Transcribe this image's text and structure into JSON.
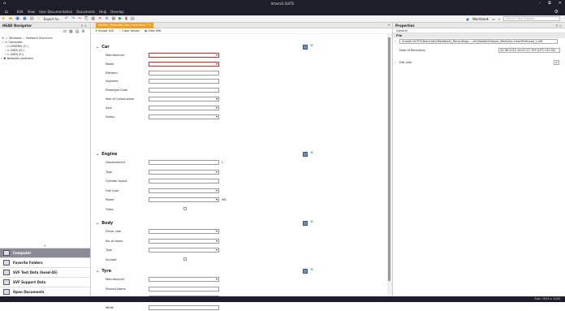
{
  "window": {
    "title": "ArtemiS SUITE",
    "min": "–",
    "max": "⧉",
    "close": "✕"
  },
  "menu": {
    "items": [
      "Edit",
      "View",
      "User Documentation",
      "Documents",
      "Help",
      "Develop"
    ]
  },
  "toolbar": {
    "export": "Export to...",
    "workbook": "Workbook",
    "search_placeholder": "Search Help System..."
  },
  "nav": {
    "title": "HEAD Navigator",
    "pin": "⊼ ×",
    "crumb": [
      "Windows",
      "Network Shortcuts"
    ],
    "tree": [
      "Computer",
      "DISDRIV (C:)",
      "DATA (D:)",
      "DATA (E:)",
      "Network Locations"
    ],
    "bottom": [
      "Computer",
      "Favorite Folders",
      "SVF Test Data (head-4S)",
      "SVF Support Data",
      "Open Documents"
    ]
  },
  "editor": {
    "tab": "Vehicle_Template_Use_Case.hdvc *",
    "tools": [
      "Import UDI",
      "Clear Values",
      "View XML"
    ],
    "sections": [
      {
        "name": "Car",
        "rows": [
          {
            "label": "Manufacturer",
            "type": "select",
            "err": true
          },
          {
            "label": "Model",
            "type": "select",
            "err": true
          },
          {
            "label": "Platform",
            "type": "text"
          },
          {
            "label": "Segment",
            "type": "text"
          },
          {
            "label": "Prototype Code",
            "type": "text"
          },
          {
            "label": "Year of Construction",
            "type": "select"
          },
          {
            "label": "Axle",
            "type": "select"
          },
          {
            "label": "Status",
            "type": "select"
          }
        ]
      },
      {
        "name": "Engine",
        "rows": [
          {
            "label": "Displacement",
            "type": "text",
            "unit": "L"
          },
          {
            "label": "Type",
            "type": "select"
          },
          {
            "label": "Cylinder layout",
            "type": "text"
          },
          {
            "label": "Fuel type",
            "type": "select"
          },
          {
            "label": "Power",
            "type": "select",
            "unit": "kW"
          },
          {
            "label": "Turbo",
            "type": "check"
          }
        ]
      },
      {
        "name": "Body",
        "rows": [
          {
            "label": "Driver side",
            "type": "select"
          },
          {
            "label": "No. of doors",
            "type": "select"
          },
          {
            "label": "Type",
            "type": "select"
          },
          {
            "label": "Sunroof",
            "type": "check"
          }
        ]
      },
      {
        "name": "Tyre",
        "rows": [
          {
            "label": "Manufacturer",
            "type": "select"
          },
          {
            "label": "Product Name",
            "type": "text"
          },
          {
            "label": "Prototype Code",
            "type": "text"
          },
          {
            "label": "Width",
            "type": "text"
          }
        ]
      }
    ]
  },
  "props": {
    "title": "Properties",
    "tab": "General",
    "group": "File",
    "path": "\\\\head-hh\\TFS\\Branches\\Testdaten\\_Recordings-...-en\\Skoda\\Exhaust_Mod\\2nd-Gear\\PartLoad_1.hdf",
    "date_label": "Date of Recording",
    "date": "20.06.2012 16:47:27.795 (UTC+02:00)",
    "edit": "Edit with"
  },
  "status": "Size: 1920 x 1040"
}
